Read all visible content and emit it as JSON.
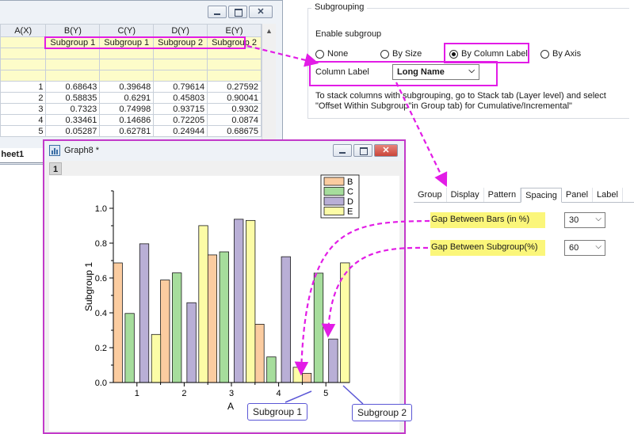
{
  "worksheet": {
    "columns": [
      "A(X)",
      "B(Y)",
      "C(Y)",
      "D(Y)",
      "E(Y)"
    ],
    "subgroup_row": [
      "",
      "Subgroup 1",
      "Subgroup 1",
      "Subgroup 2",
      "Subgroup 2"
    ],
    "rows": [
      [
        "1",
        "0.68643",
        "0.39648",
        "0.79614",
        "0.27592"
      ],
      [
        "2",
        "0.58835",
        "0.6291",
        "0.45803",
        "0.90041"
      ],
      [
        "3",
        "0.7323",
        "0.74998",
        "0.93715",
        "0.9302"
      ],
      [
        "4",
        "0.33461",
        "0.14686",
        "0.72205",
        "0.0874"
      ],
      [
        "5",
        "0.05287",
        "0.62781",
        "0.24944",
        "0.68675"
      ]
    ],
    "sheet_tab": "heet1",
    "win_close": "✕"
  },
  "subgrouping": {
    "section_title": "Subgrouping",
    "enable_label": "Enable subgroup",
    "options": [
      "None",
      "By Size",
      "By Column Label",
      "By Axis"
    ],
    "selected": "By Column Label",
    "column_label_text": "Column Label",
    "column_label_value": "Long Name",
    "note_line1": "To stack columns with subgrouping, go to Stack tab (Layer level) and select",
    "note_line2": "\"Offset Within Subgroup\"in Group tab) for Cumulative/Incremental\""
  },
  "spacing": {
    "tabs": [
      "Group",
      "Display",
      "Pattern",
      "Spacing",
      "Panel",
      "Label"
    ],
    "active_tab": "Spacing",
    "gap_bars_label": "Gap Between Bars (in %)",
    "gap_bars_value": "30",
    "gap_sub_label": "Gap Between Subgroup(%)",
    "gap_sub_value": "60"
  },
  "graph": {
    "window_title": "Graph8 *",
    "layer": "1",
    "win_close": "✕"
  },
  "callouts": {
    "subgroup1": "Subgroup 1",
    "subgroup2": "Subgroup 2"
  },
  "colors": {
    "accent_magenta": "#e21ce6",
    "highlight_yellow": "#fbf67a",
    "B": "#fbcca0",
    "C": "#a6dd9c",
    "D": "#b9afd6",
    "E": "#fcfca6"
  },
  "chart_data": {
    "type": "bar",
    "categories": [
      "1",
      "2",
      "3",
      "4",
      "5"
    ],
    "series": [
      {
        "name": "B",
        "color": "#fbcca0",
        "values": [
          0.68643,
          0.58835,
          0.7323,
          0.33461,
          0.05287
        ]
      },
      {
        "name": "C",
        "color": "#a6dd9c",
        "values": [
          0.39648,
          0.6291,
          0.74998,
          0.14686,
          0.62781
        ]
      },
      {
        "name": "D",
        "color": "#b9afd6",
        "values": [
          0.79614,
          0.45803,
          0.93715,
          0.72205,
          0.24944
        ]
      },
      {
        "name": "E",
        "color": "#fcfca6",
        "values": [
          0.27592,
          0.90041,
          0.9302,
          0.0874,
          0.68675
        ]
      }
    ],
    "title": "",
    "xlabel": "A",
    "ylabel": "Subgroup 1",
    "ylim": [
      0,
      1.1
    ],
    "yticks": [
      "0.0",
      "0.2",
      "0.4",
      "0.6",
      "0.8",
      "1.0"
    ],
    "legend": "top-right",
    "grid": false
  }
}
